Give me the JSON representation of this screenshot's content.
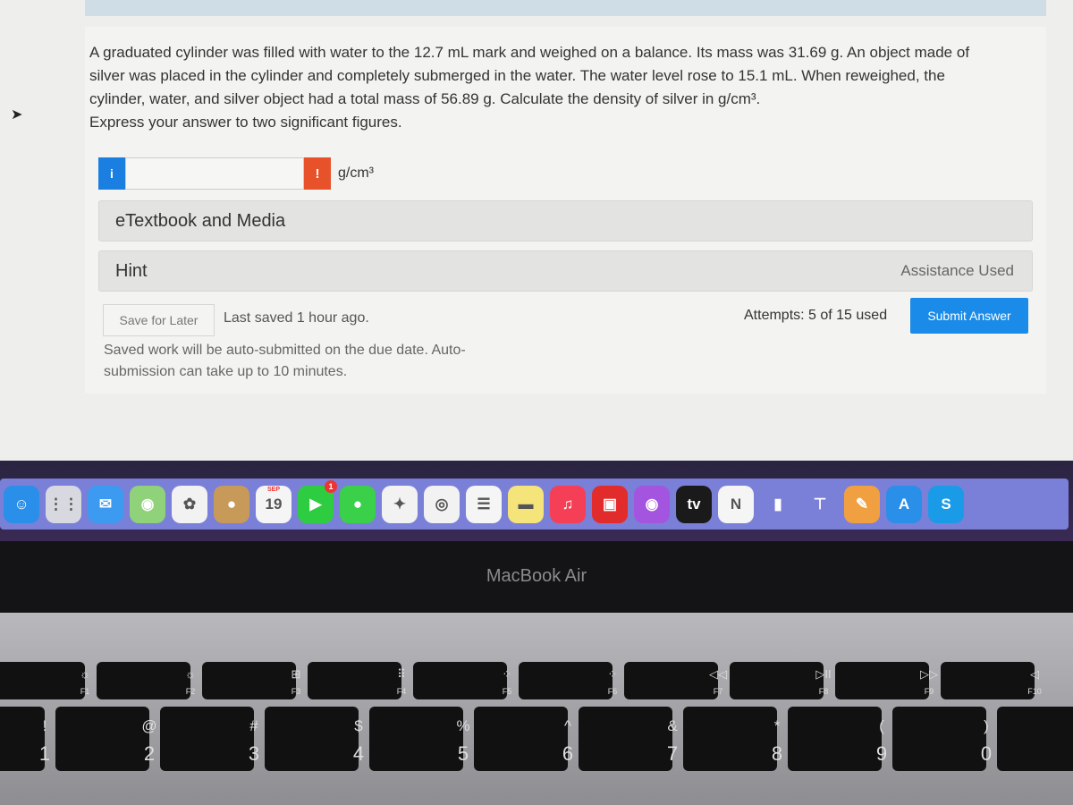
{
  "question": {
    "lines": [
      "A graduated cylinder was filled with water to the 12.7 mL mark and weighed on a balance. Its mass was 31.69 g. An object made of",
      "silver was placed in the cylinder and completely submerged in the water. The water level rose to 15.1 mL. When reweighed, the",
      "cylinder, water, and silver object had a total mass of 56.89 g. Calculate the density of silver in g/cm³.",
      "Express your answer to two significant figures."
    ]
  },
  "answer": {
    "info_icon": "i",
    "value": "",
    "warning_icon": "!",
    "unit": "g/cm³"
  },
  "panels": {
    "etextbook": "eTextbook and Media",
    "hint": "Hint",
    "assistance": "Assistance Used"
  },
  "footer": {
    "save_label": "Save for Later",
    "last_saved": "Last saved 1 hour ago.",
    "auto_submit_note": "Saved work will be auto-submitted on the due date. Auto-submission can take up to 10 minutes.",
    "attempts": "Attempts: 5 of 15 used",
    "submit_label": "Submit Answer"
  },
  "dock": {
    "apps": [
      {
        "name": "finder",
        "glyph": "☺",
        "color": "#2a8fe8"
      },
      {
        "name": "launchpad",
        "glyph": "⋮⋮",
        "color": "#d8d8e0"
      },
      {
        "name": "mail",
        "glyph": "✉",
        "color": "#3c9af0"
      },
      {
        "name": "maps",
        "glyph": "◉",
        "color": "#8fd27a"
      },
      {
        "name": "photos",
        "glyph": "✿",
        "color": "#f2f2f2"
      },
      {
        "name": "contacts",
        "glyph": "●",
        "color": "#c89a5a"
      },
      {
        "name": "calendar",
        "glyph": "19",
        "color": "#f5f5f5",
        "month": "SEP"
      },
      {
        "name": "facetime",
        "glyph": "▶",
        "color": "#2ecc40",
        "badge": "1"
      },
      {
        "name": "messages",
        "glyph": "●",
        "color": "#3ad04a"
      },
      {
        "name": "safari",
        "glyph": "✦",
        "color": "#f2f2f2"
      },
      {
        "name": "chrome",
        "glyph": "◎",
        "color": "#f2f2f2"
      },
      {
        "name": "reminders",
        "glyph": "☰",
        "color": "#f5f5f5"
      },
      {
        "name": "notes",
        "glyph": "▬",
        "color": "#f5e47a"
      },
      {
        "name": "music",
        "glyph": "♫",
        "color": "#f43f56"
      },
      {
        "name": "photo-booth",
        "glyph": "▣",
        "color": "#e22b2b"
      },
      {
        "name": "podcasts",
        "glyph": "◉",
        "color": "#a455e0"
      },
      {
        "name": "apple-tv",
        "glyph": "tv",
        "color": "#1a1a1a"
      },
      {
        "name": "news",
        "glyph": "N",
        "color": "#f5f5f5"
      },
      {
        "name": "numbers",
        "glyph": "▮",
        "color": "#7a7fd8"
      },
      {
        "name": "keynote",
        "glyph": "⊤",
        "color": "#7a7fd8"
      },
      {
        "name": "pages",
        "glyph": "✎",
        "color": "#f0a040"
      },
      {
        "name": "app-store",
        "glyph": "A",
        "color": "#2a8fe8"
      },
      {
        "name": "skype",
        "glyph": "S",
        "color": "#1a9be8"
      }
    ]
  },
  "laptop": {
    "brand": "MacBook Air"
  },
  "keyboard": {
    "function_keys": [
      {
        "sym": "☼",
        "label": "F1"
      },
      {
        "sym": "☼",
        "label": "F2"
      },
      {
        "sym": "⊞",
        "label": "F3"
      },
      {
        "sym": "⠿",
        "label": "F4"
      },
      {
        "sym": "⁘",
        "label": "F5"
      },
      {
        "sym": "⁘",
        "label": "F6"
      },
      {
        "sym": "◁◁",
        "label": "F7"
      },
      {
        "sym": "▷II",
        "label": "F8"
      },
      {
        "sym": "▷▷",
        "label": "F9"
      },
      {
        "sym": "◁",
        "label": "F10"
      }
    ],
    "number_keys": [
      {
        "top": "!",
        "bottom": "1"
      },
      {
        "top": "@",
        "bottom": "2"
      },
      {
        "top": "#",
        "bottom": "3"
      },
      {
        "top": "$",
        "bottom": "4"
      },
      {
        "top": "%",
        "bottom": "5"
      },
      {
        "top": "^",
        "bottom": "6"
      },
      {
        "top": "&",
        "bottom": "7"
      },
      {
        "top": "*",
        "bottom": "8"
      },
      {
        "top": "(",
        "bottom": "9"
      },
      {
        "top": ")",
        "bottom": "0"
      },
      {
        "top": "—",
        "bottom": "-"
      }
    ]
  }
}
